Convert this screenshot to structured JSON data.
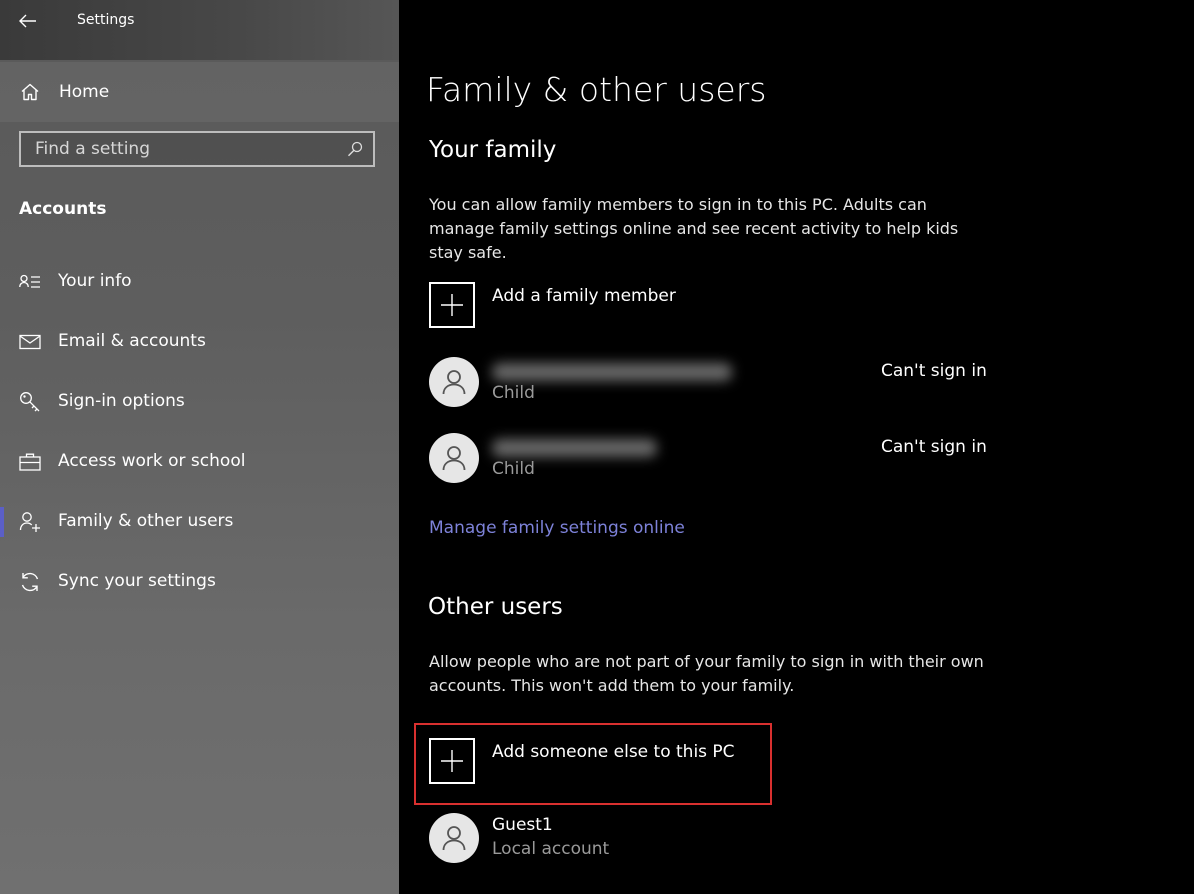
{
  "window": {
    "title": "Settings"
  },
  "sidebar": {
    "home_label": "Home",
    "search_placeholder": "Find a setting",
    "section_title": "Accounts",
    "items": [
      {
        "label": "Your info",
        "icon": "contact-card-icon"
      },
      {
        "label": "Email & accounts",
        "icon": "mail-icon"
      },
      {
        "label": "Sign-in options",
        "icon": "key-icon"
      },
      {
        "label": "Access work or school",
        "icon": "briefcase-icon"
      },
      {
        "label": "Family & other users",
        "icon": "add-person-icon",
        "active": true
      },
      {
        "label": "Sync your settings",
        "icon": "sync-icon"
      }
    ],
    "accent_color": "#5b5fc7"
  },
  "main": {
    "page_title": "Family & other users",
    "family": {
      "heading": "Your family",
      "description": "You can allow family members to sign in to this PC. Adults can manage family settings online and see recent activity to help kids stay safe.",
      "add_label": "Add a family member",
      "members": [
        {
          "role": "Child",
          "status": "Can't sign in"
        },
        {
          "role": "Child",
          "status": "Can't sign in"
        }
      ],
      "manage_link": "Manage family settings online"
    },
    "other": {
      "heading": "Other users",
      "description": "Allow people who are not part of your family to sign in with their own accounts. This won't add them to your family.",
      "add_label": "Add someone else to this PC",
      "users": [
        {
          "name": "Guest1",
          "type": "Local account"
        }
      ]
    },
    "highlight_color": "#d9302f",
    "link_color": "#7d82d9"
  }
}
